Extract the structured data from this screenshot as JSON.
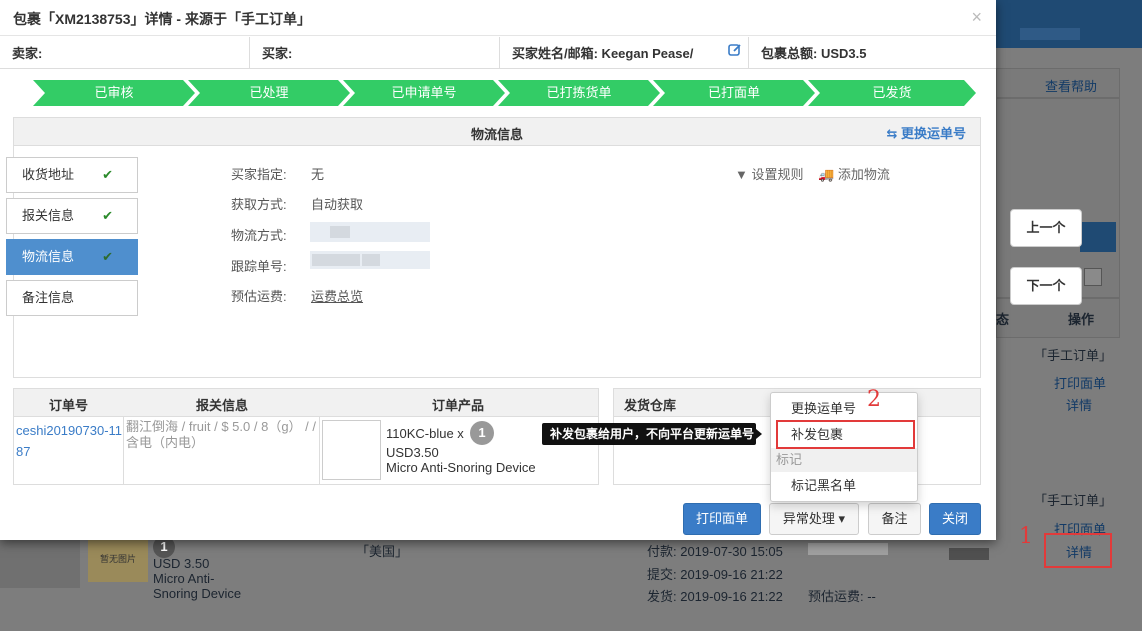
{
  "modal": {
    "title": "包裹「XM2138753」详情 - 来源于「手工订单」",
    "close": "×",
    "info": {
      "seller": "卖家:",
      "buyer": "买家:",
      "buyer_name": "买家姓名/邮箱:  Keegan Pease/",
      "total": "包裹总额:  USD3.5"
    },
    "steps": [
      "已审核",
      "已处理",
      "已申请单号",
      "已打拣货单",
      "已打面单",
      "已发货"
    ],
    "logistics": {
      "title": "物流信息",
      "swap_label": "⇆ 更换运单号",
      "set_rule": "设置规则",
      "add_logistics": "添加物流",
      "fields": [
        {
          "label": "买家指定:",
          "value": "无"
        },
        {
          "label": "获取方式:",
          "value": "自动获取"
        },
        {
          "label": "物流方式:",
          "value": ""
        },
        {
          "label": "跟踪单号:",
          "value": ""
        },
        {
          "label": "预估运费:",
          "value": "运费总览"
        }
      ]
    },
    "nav": [
      {
        "label": "收货地址",
        "check": "✔"
      },
      {
        "label": "报关信息",
        "check": "✔"
      },
      {
        "label": "物流信息",
        "check": "✔"
      },
      {
        "label": "备注信息",
        "check": ""
      }
    ],
    "order_table": {
      "headers": [
        "订单号",
        "报关信息",
        "订单产品"
      ],
      "order_no": "ceshi20190730-1187",
      "customs": "翻江倒海 /  fruit /  $ 5.0 /  8（g） /  / 含电（内电）",
      "product_sku": "110KC-blue x",
      "product_qty": "1",
      "product_price": "USD3.50",
      "product_name": "Micro Anti-Snoring Device"
    },
    "warehouse_header": "发货仓库",
    "buttons": {
      "print": "打印面单",
      "exception": "异常处理 ▾",
      "note": "备注",
      "close": "关闭"
    }
  },
  "dropdown": {
    "items": [
      "更换运单号",
      "补发包裹"
    ],
    "group": "标记",
    "group_items": [
      "标记黑名单"
    ]
  },
  "tooltip": "补发包裹给用户，不向平台更新运单号",
  "annotations": {
    "one": "1",
    "two": "2"
  },
  "nav_buttons": {
    "prev": "上一个",
    "next": "下一个"
  },
  "background": {
    "help": "查看帮助",
    "col_status": "态",
    "col_action": "操作",
    "source1": "「手工订单」",
    "source2": "「手工订单」",
    "print1": "打印面单",
    "detail1": "详情",
    "print2": "打印面单",
    "detail2": "详情",
    "country": "「美国」",
    "price": "USD 3.50",
    "product": "Micro Anti-Snoring Device",
    "qty": "1",
    "paid": "付款:  2019-07-30 15:05",
    "submit": "提交:  2019-09-16 21:22",
    "ship": "发货:  2019-09-16 21:22",
    "freight": "预估运费: --",
    "nopic": "暂无图片"
  }
}
